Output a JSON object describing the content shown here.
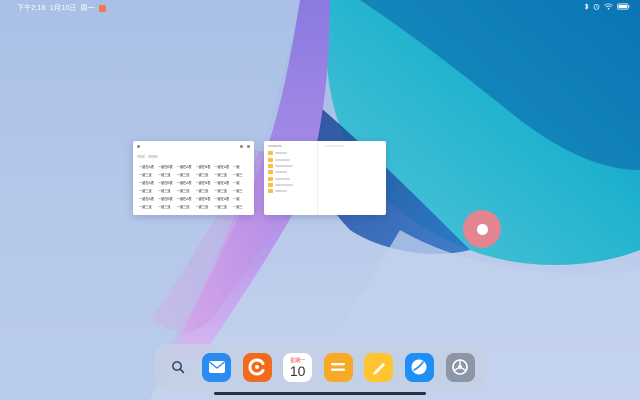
{
  "status_bar": {
    "time": "下午2:18",
    "date": "1月10日",
    "weekday": "周一",
    "icons": [
      "notification-badge-icon",
      "bluetooth-icon",
      "alarm-icon",
      "wifi-icon",
      "battery-icon"
    ]
  },
  "recent_windows": {
    "document": {
      "cells": [
        "一键在A表",
        "一键在B表",
        "一键在A表",
        "一键在B表",
        "一键在A表",
        "一键",
        "一键三连",
        "一键三连",
        "一键三连",
        "一键三连",
        "一键三连",
        "一键三",
        "一键在A表",
        "一键在B表",
        "一键在A表",
        "一键在B表",
        "一键在A表",
        "一键",
        "一键三连",
        "一键三连",
        "一键三连",
        "一键三连",
        "一键三连",
        "一键三",
        "一键在A表",
        "一键在B表",
        "一键在A表",
        "一键在B表",
        "一键在A表",
        "一键",
        "一键三连",
        "一键三连",
        "一键三连",
        "一键三连",
        "一键三连",
        "一键三"
      ]
    },
    "file_manager": {
      "folders": [
        "",
        "",
        "",
        "",
        "",
        "",
        ""
      ]
    }
  },
  "floating_button": {
    "color": "#f1808b"
  },
  "dock": {
    "apps": [
      "search-icon",
      "mail-icon",
      "orange-app-icon",
      "calendar-icon",
      "notes-icon",
      "pen-icon",
      "messages-icon",
      "settings-icon"
    ],
    "calendar": {
      "day": "星期一",
      "date": "10"
    }
  },
  "colors": {
    "accent_orange": "#f26a1b",
    "mail_blue": "#2a8cf0",
    "notes_yellow": "#f7a928",
    "float_pink": "#f1808b"
  }
}
